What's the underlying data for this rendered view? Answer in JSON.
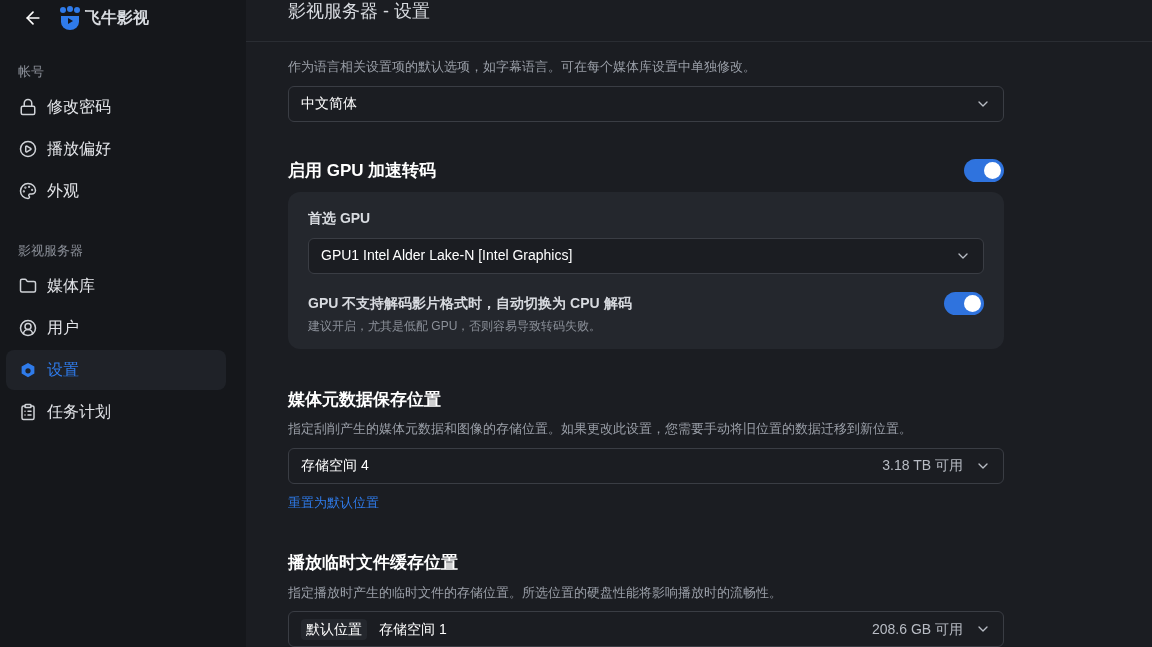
{
  "app": {
    "name": "飞牛影视"
  },
  "sidebar": {
    "groups": [
      {
        "label": "帐号",
        "items": [
          {
            "label": "修改密码",
            "kind": "lock",
            "selected": false
          },
          {
            "label": "播放偏好",
            "kind": "play",
            "selected": false
          },
          {
            "label": "外观",
            "kind": "palette",
            "selected": false
          }
        ]
      },
      {
        "label": "影视服务器",
        "items": [
          {
            "label": "媒体库",
            "kind": "folder",
            "selected": false
          },
          {
            "label": "用户",
            "kind": "user",
            "selected": false
          },
          {
            "label": "设置",
            "kind": "gear",
            "selected": true
          },
          {
            "label": "任务计划",
            "kind": "clipboard",
            "selected": false
          }
        ]
      }
    ]
  },
  "header": {
    "title": "影视服务器 - 设置"
  },
  "language": {
    "description": "作为语言相关设置项的默认选项，如字幕语言。可在每个媒体库设置中单独修改。",
    "value": "中文简体"
  },
  "gpu": {
    "title": "启用 GPU 加速转码",
    "on": true,
    "preferred_label": "首选 GPU",
    "preferred_value": "GPU1 Intel Alder Lake-N [Intel Graphics]",
    "fallback_title": "GPU 不支持解码影片格式时，自动切换为 CPU 解码",
    "fallback_hint": "建议开启，尤其是低配 GPU，否则容易导致转码失败。",
    "fallback_on": true
  },
  "metadata": {
    "title": "媒体元数据保存位置",
    "description": "指定刮削产生的媒体元数据和图像的存储位置。如果更改此设置，您需要手动将旧位置的数据迁移到新位置。",
    "value": "存储空间 4",
    "free": "3.18 TB 可用",
    "reset_link": "重置为默认位置"
  },
  "cache": {
    "title": "播放临时文件缓存位置",
    "description": "指定播放时产生的临时文件的存储位置。所选位置的硬盘性能将影响播放时的流畅性。",
    "tag": "默认位置",
    "value": "存储空间 1",
    "free": "208.6 GB 可用"
  }
}
